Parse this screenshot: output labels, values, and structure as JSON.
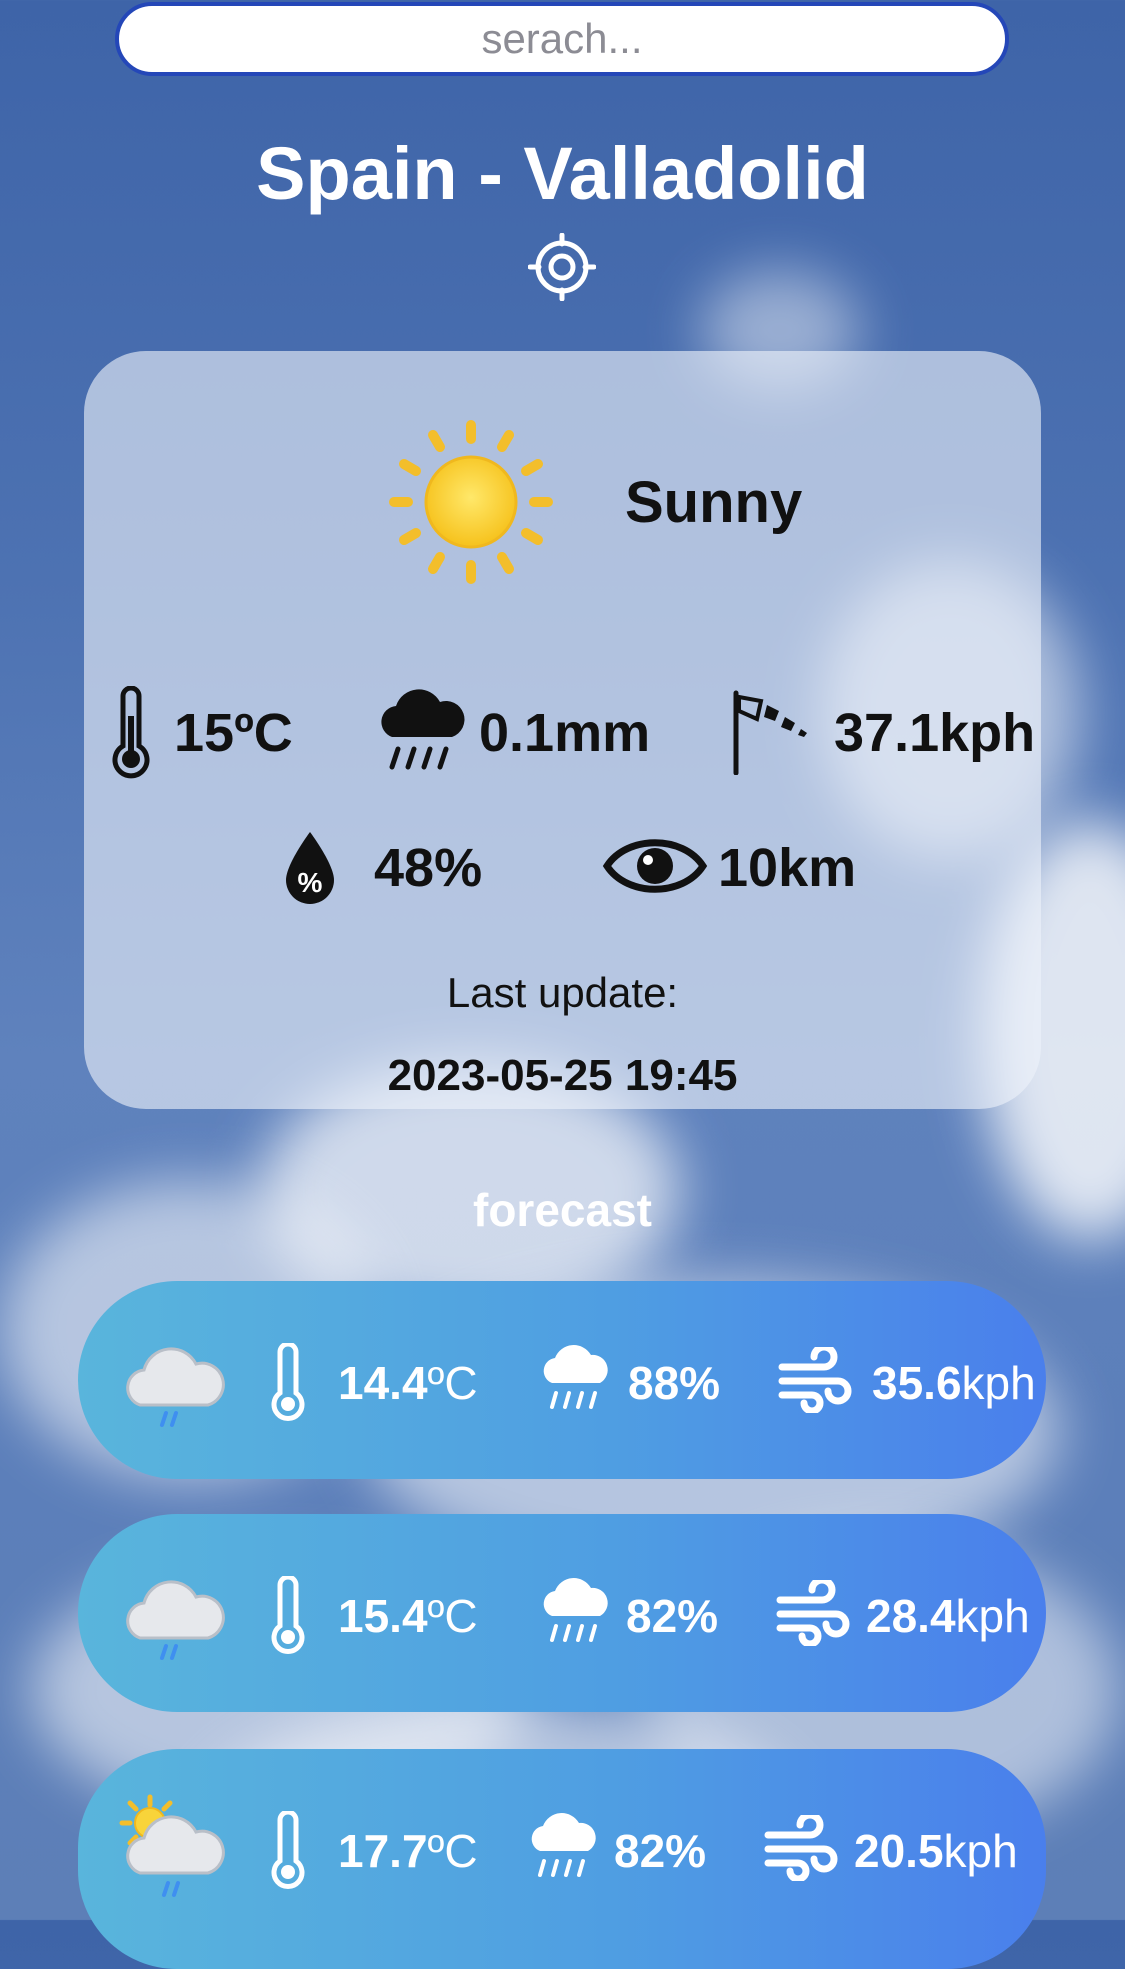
{
  "search": {
    "placeholder": "serach..."
  },
  "location": {
    "title": "Spain - Valladolid"
  },
  "current": {
    "condition": "Sunny",
    "temperature": "15ºC",
    "precipitation": "0.1mm",
    "wind": "37.1kph",
    "humidity": "48%",
    "visibility": "10km",
    "last_update_label": "Last update:",
    "last_update_value": "2023-05-25 19:45"
  },
  "forecast": {
    "title": "forecast",
    "items": [
      {
        "icon": "rain-cloud-icon",
        "temp_value": "14.4",
        "temp_unit": "ºC",
        "rain_chance": "88%",
        "wind_value": "35.6",
        "wind_unit": "kph"
      },
      {
        "icon": "rain-cloud-icon",
        "temp_value": "15.4",
        "temp_unit": "ºC",
        "rain_chance": "82%",
        "wind_value": "28.4",
        "wind_unit": "kph"
      },
      {
        "icon": "sun-rain-cloud-icon",
        "temp_value": "17.7",
        "temp_unit": "ºC",
        "rain_chance": "82%",
        "wind_value": "20.5",
        "wind_unit": "kph"
      }
    ]
  },
  "colors": {
    "search_border": "#2447b8",
    "forecast_gradient_start": "#59b5dc",
    "forecast_gradient_end": "#4a7fec",
    "card_background": "#eef2fa"
  }
}
